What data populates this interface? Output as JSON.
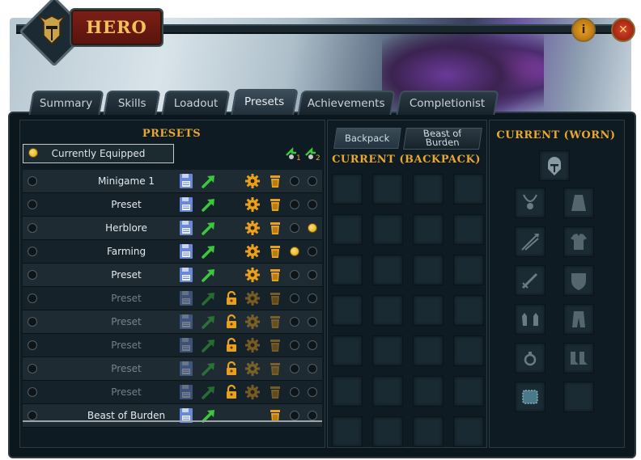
{
  "window": {
    "title": "HERO",
    "info_icon": "info-icon",
    "close_icon": "close-icon"
  },
  "tabs": [
    {
      "label": "Summary",
      "active": false
    },
    {
      "label": "Skills",
      "active": false
    },
    {
      "label": "Loadout",
      "active": false
    },
    {
      "label": "Presets",
      "active": true
    },
    {
      "label": "Achievements",
      "active": false
    },
    {
      "label": "Completionist",
      "active": false
    }
  ],
  "presets": {
    "title": "PRESETS",
    "currently_equipped_label": "Currently Equipped",
    "slot1_label": "1",
    "slot2_label": "2",
    "rows": [
      {
        "name": "Minigame 1",
        "locked": false,
        "has_gear": true,
        "slot1": false,
        "slot2": false
      },
      {
        "name": "Preset",
        "locked": false,
        "has_gear": true,
        "slot1": false,
        "slot2": false
      },
      {
        "name": "Herblore",
        "locked": false,
        "has_gear": true,
        "slot1": false,
        "slot2": true
      },
      {
        "name": "Farming",
        "locked": false,
        "has_gear": true,
        "slot1": true,
        "slot2": false
      },
      {
        "name": "Preset",
        "locked": false,
        "has_gear": true,
        "slot1": false,
        "slot2": false
      },
      {
        "name": "Preset",
        "locked": true,
        "has_gear": true,
        "slot1": false,
        "slot2": false
      },
      {
        "name": "Preset",
        "locked": true,
        "has_gear": true,
        "slot1": false,
        "slot2": false
      },
      {
        "name": "Preset",
        "locked": true,
        "has_gear": true,
        "slot1": false,
        "slot2": false
      },
      {
        "name": "Preset",
        "locked": true,
        "has_gear": true,
        "slot1": false,
        "slot2": false
      },
      {
        "name": "Preset",
        "locked": true,
        "has_gear": true,
        "slot1": false,
        "slot2": false
      },
      {
        "name": "Beast of Burden",
        "locked": false,
        "has_gear": false,
        "slot1": false,
        "slot2": false
      }
    ]
  },
  "backpack": {
    "tab_backpack": "Backpack",
    "tab_beast_line1": "Beast of",
    "tab_beast_line2": "Burden",
    "title": "CURRENT (BACKPACK)"
  },
  "worn": {
    "title": "CURRENT (WORN)",
    "slots": [
      "helmet-icon",
      "amulet-icon",
      "cape-icon",
      "arrows-icon",
      "body-armour-icon",
      "sword-icon",
      "shield-icon",
      "gloves-icon",
      "legs-icon",
      "ring-icon",
      "boots-icon",
      "aura-icon",
      "empty-slot"
    ]
  },
  "colors": {
    "gold_title": "#e8a830",
    "title_plate": "#7a1e16",
    "save_icon": "#6b88d8",
    "load_arrow": "#3cc83c",
    "gear_icon": "#e8a020"
  }
}
